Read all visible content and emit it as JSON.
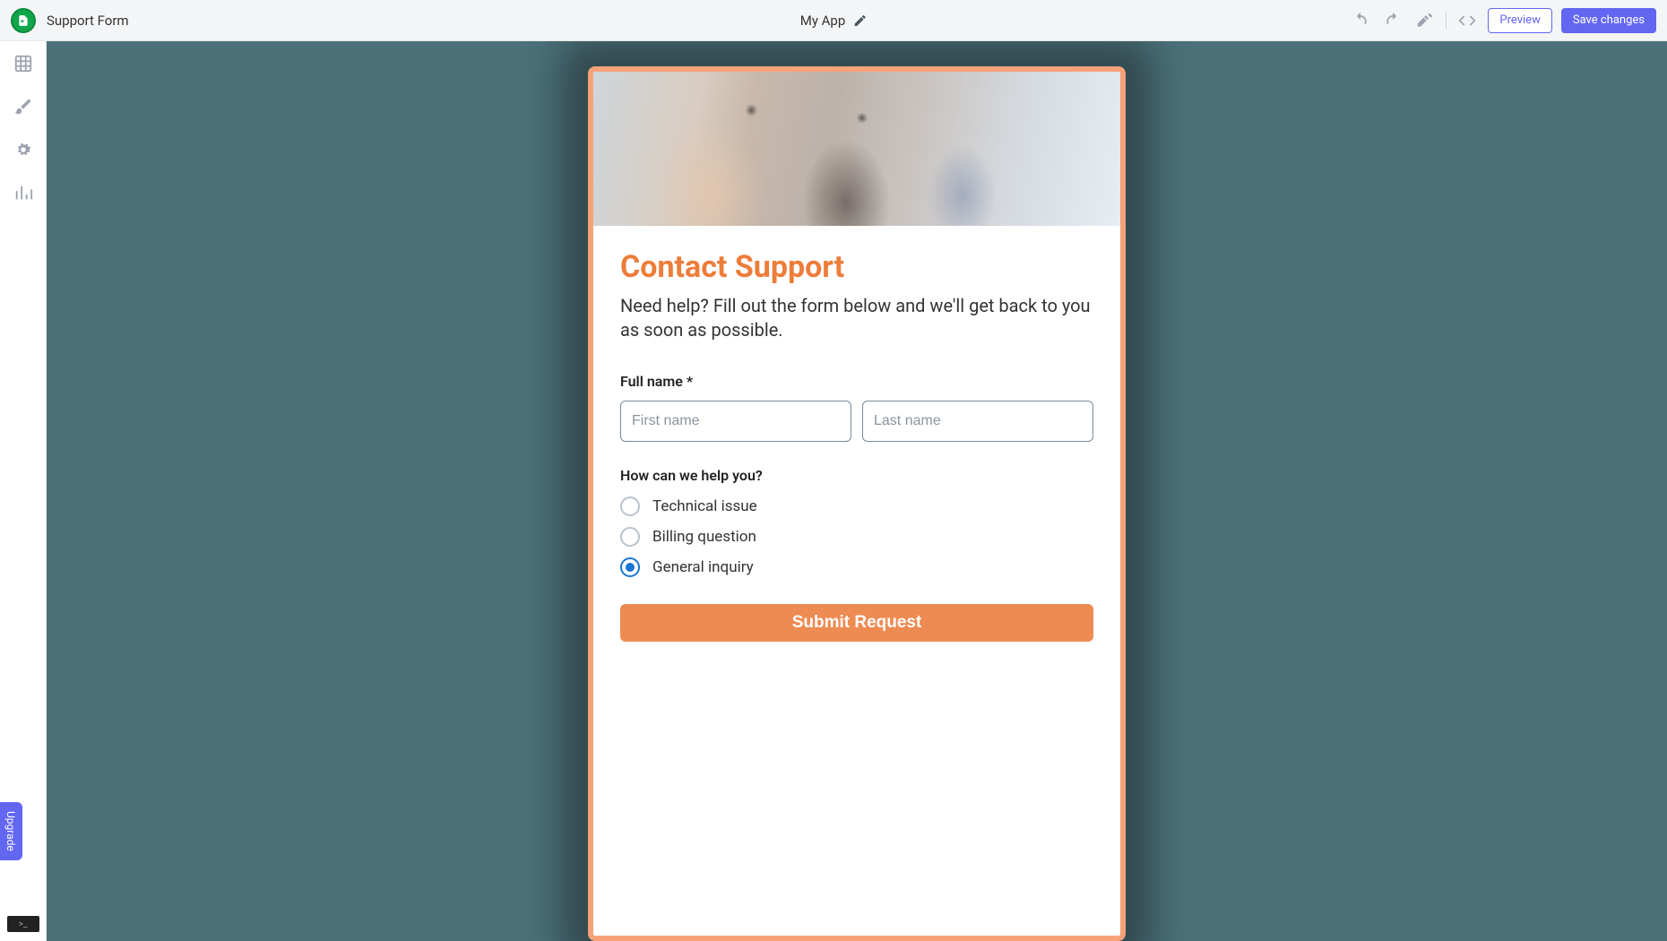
{
  "topbar": {
    "page_title": "Support Form",
    "app_name": "My App",
    "preview_label": "Preview",
    "save_label": "Save changes"
  },
  "rail": {
    "upgrade_label": "Upgrade"
  },
  "form": {
    "heading": "Contact Support",
    "subheading": "Need help? Fill out the form below and we'll get back to you as soon as possible.",
    "full_name_label": "Full name *",
    "first_name_placeholder": "First name",
    "last_name_placeholder": "Last name",
    "help_label": "How can we help you?",
    "options": [
      {
        "label": "Technical issue",
        "checked": false
      },
      {
        "label": "Billing question",
        "checked": false
      },
      {
        "label": "General inquiry",
        "checked": true
      }
    ],
    "submit_label": "Submit Request"
  },
  "colors": {
    "accent_orange": "#ed7d3a",
    "button_orange": "#ee8b52",
    "primary_indigo": "#6366f1",
    "canvas_bg": "#4b7078",
    "card_border": "#f8a27a",
    "radio_checked": "#1976d2"
  }
}
